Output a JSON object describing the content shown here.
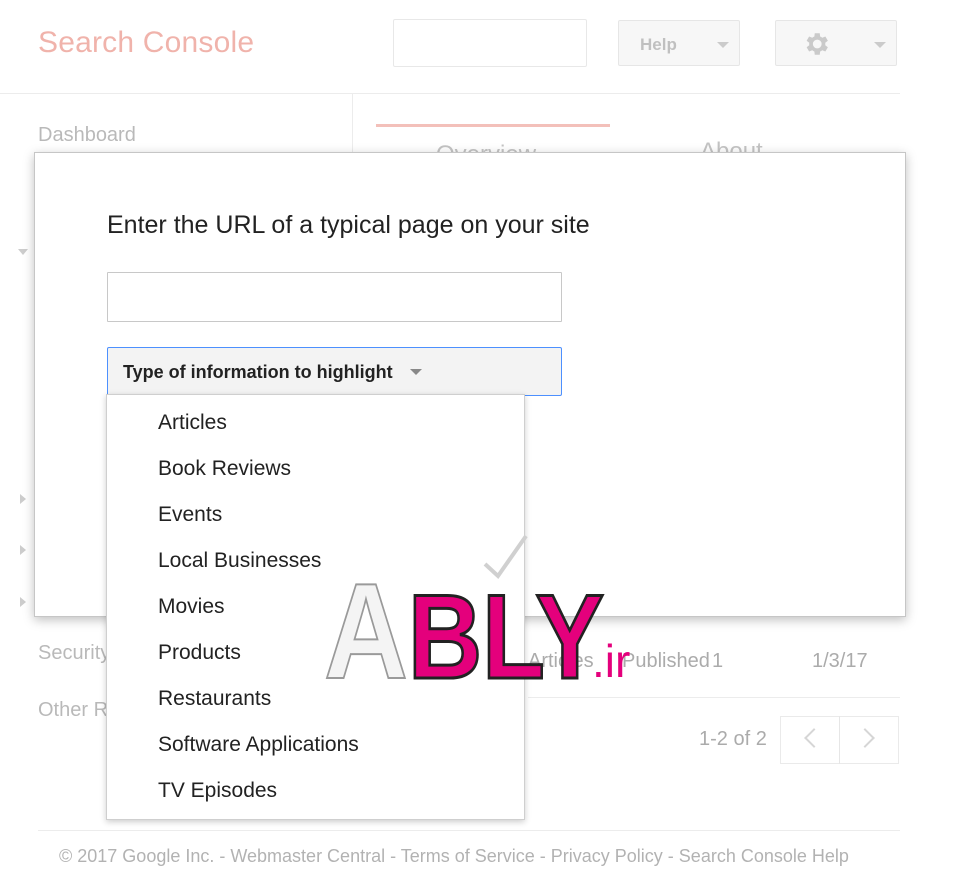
{
  "header": {
    "logo": "Search Console",
    "help_label": "Help"
  },
  "sidebar": {
    "items": [
      {
        "label": "Dashboard"
      },
      {
        "label": "Security Issues"
      },
      {
        "label": "Other Resources"
      }
    ]
  },
  "tabs": [
    {
      "label": "Overview"
    },
    {
      "label": "About"
    }
  ],
  "table": {
    "row": {
      "type": "Articles",
      "status": "Published",
      "pages": "1",
      "date": "1/3/17"
    },
    "pager_text": "1-2 of 2"
  },
  "footer": {
    "text": "© 2017 Google Inc. - Webmaster Central - Terms of Service - Privacy Policy - Search Console Help"
  },
  "dialog": {
    "title": "Enter the URL of a typical page on your site",
    "url_value": "",
    "select_label": "Type of information to highlight"
  },
  "menu": {
    "items": [
      "Articles",
      "Book Reviews",
      "Events",
      "Local Businesses",
      "Movies",
      "Products",
      "Restaurants",
      "Software Applications",
      "TV Episodes"
    ]
  },
  "watermark": {
    "text": "ABLY",
    "suffix": ".ir"
  },
  "colors": {
    "brand_red": "#dd4b39",
    "focus_blue": "#4d90fe",
    "watermark_magenta": "#e4007c"
  }
}
